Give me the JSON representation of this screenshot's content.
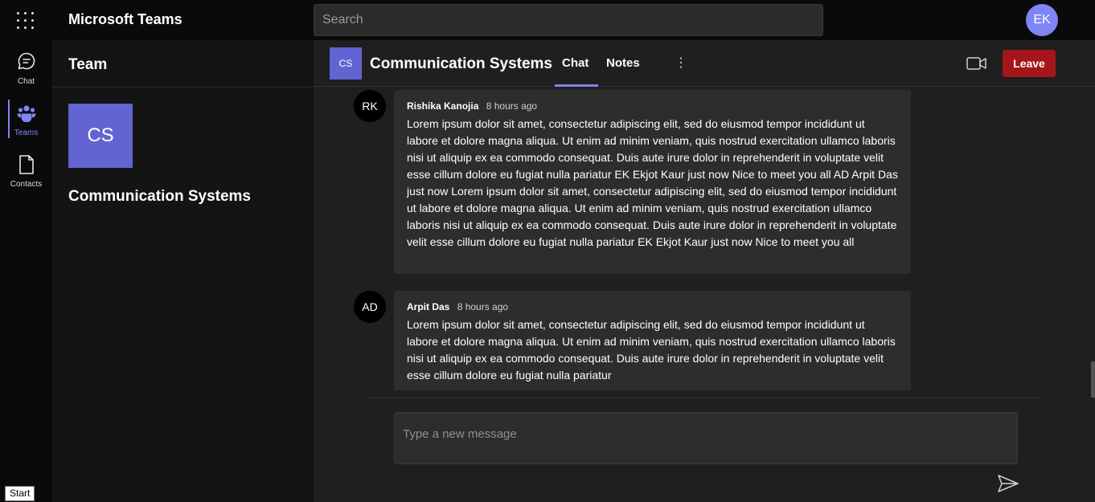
{
  "app": {
    "title": "Microsoft Teams"
  },
  "search": {
    "placeholder": "Search"
  },
  "user": {
    "initials": "EK"
  },
  "rail": {
    "items": [
      {
        "label": "Chat",
        "icon": "chat-icon"
      },
      {
        "label": "Teams",
        "icon": "teams-icon"
      },
      {
        "label": "Contacts",
        "icon": "contacts-icon"
      }
    ]
  },
  "panel": {
    "title": "Team",
    "team": {
      "initials": "CS",
      "name": "Communication Systems"
    }
  },
  "channel": {
    "initials": "CS",
    "name": "Communication Systems",
    "tabs": [
      {
        "label": "Chat"
      },
      {
        "label": "Notes"
      }
    ],
    "more": "⋮",
    "leave_label": "Leave"
  },
  "messages": [
    {
      "initials": "RK",
      "author": "Rishika Kanojia",
      "time": "8 hours ago",
      "text": "Lorem ipsum dolor sit amet, consectetur adipiscing elit, sed do eiusmod tempor incididunt ut labore et dolore magna aliqua. Ut enim ad minim veniam, quis nostrud exercitation ullamco laboris nisi ut aliquip ex ea commodo consequat. Duis aute irure dolor in reprehenderit in voluptate velit esse cillum dolore eu fugiat nulla pariatur EK Ekjot Kaur just now Nice to meet you all AD Arpit Das just now Lorem ipsum dolor sit amet, consectetur adipiscing elit, sed do eiusmod tempor incididunt ut labore et dolore magna aliqua. Ut enim ad minim veniam, quis nostrud exercitation ullamco laboris nisi ut aliquip ex ea commodo consequat. Duis aute irure dolor in reprehenderit in voluptate velit esse cillum dolore eu fugiat nulla pariatur EK Ekjot Kaur just now Nice to meet you all"
    },
    {
      "initials": "AD",
      "author": "Arpit Das",
      "time": "8 hours ago",
      "text": "Lorem ipsum dolor sit amet, consectetur adipiscing elit, sed do eiusmod tempor incididunt ut labore et dolore magna aliqua. Ut enim ad minim veniam, quis nostrud exercitation ullamco laboris nisi ut aliquip ex ea commodo consequat. Duis aute irure dolor in reprehenderit in voluptate velit esse cillum dolore eu fugiat nulla pariatur"
    }
  ],
  "compose": {
    "placeholder": "Type a new message"
  },
  "tooltip": {
    "text": "Start"
  },
  "colors": {
    "accent": "#7f85f5",
    "team_tile": "#6264d1",
    "leave": "#a4161a"
  }
}
